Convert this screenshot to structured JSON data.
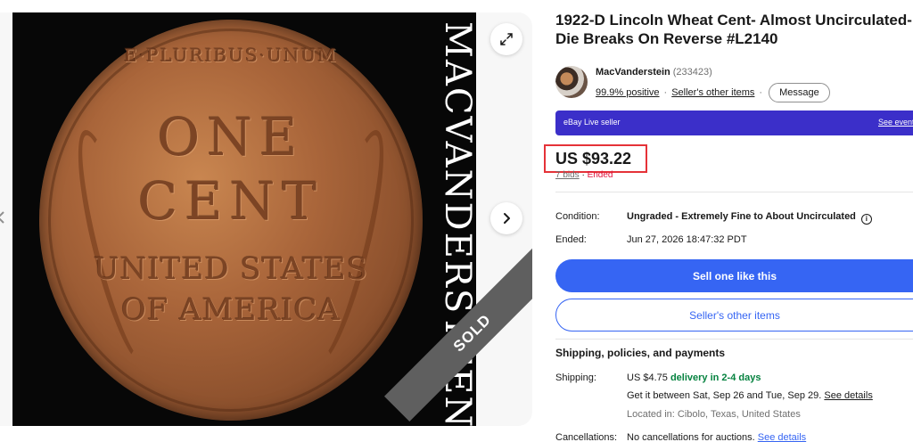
{
  "listing": {
    "title": "1922-D Lincoln Wheat Cent- Almost Uncirculated- Die Breaks On Reverse #L2140"
  },
  "gallery": {
    "watermark": "MACVANDERSTEEN",
    "sold_badge": "SOLD",
    "coin_text": {
      "motto": "E·PLURIBUS·UNUM",
      "line1": "ONE",
      "line2": "CENT",
      "line3": "UNITED STATES",
      "line4": "OF AMERICA"
    },
    "icons": {
      "expand": "expand-icon",
      "next": "chevron-right-icon",
      "prev": "chevron-left-icon"
    }
  },
  "seller": {
    "name": "MacVanderstein",
    "feedback_count": "(233423)",
    "positive": "99.9% positive",
    "other_items": "Seller's other items",
    "message_button": "Message"
  },
  "live_banner": {
    "label": "eBay Live seller",
    "link": "See event"
  },
  "price": {
    "amount": "US $93.22",
    "bids": "7 bids",
    "separator": " · ",
    "status": "Ended"
  },
  "specs": {
    "condition_label": "Condition:",
    "condition_value": "Ungraded - Extremely Fine to About Uncirculated",
    "ended_label": "Ended:",
    "ended_value": "Jun 27, 2026 18:47:32 PDT"
  },
  "actions": {
    "primary": "Sell one like this",
    "secondary": "Seller's other items"
  },
  "shipping": {
    "section_title": "Shipping, policies, and payments",
    "label": "Shipping:",
    "cost": "US $4.75",
    "delivery": "delivery in 2-4 days",
    "estimate": "Get it between Sat, Sep 26 and Tue, Sep 29.",
    "see_details": "See details",
    "location": "Located in: Cibolo, Texas, United States"
  },
  "cancellations": {
    "label": "Cancellations:",
    "value": "No cancellations for auctions.",
    "link": "See details"
  },
  "colors": {
    "primary_blue": "#3665f3",
    "live_purple": "#3b2fc9",
    "ended_red": "#e0103a",
    "highlight_red": "#e53238",
    "delivery_green": "#05823f"
  }
}
